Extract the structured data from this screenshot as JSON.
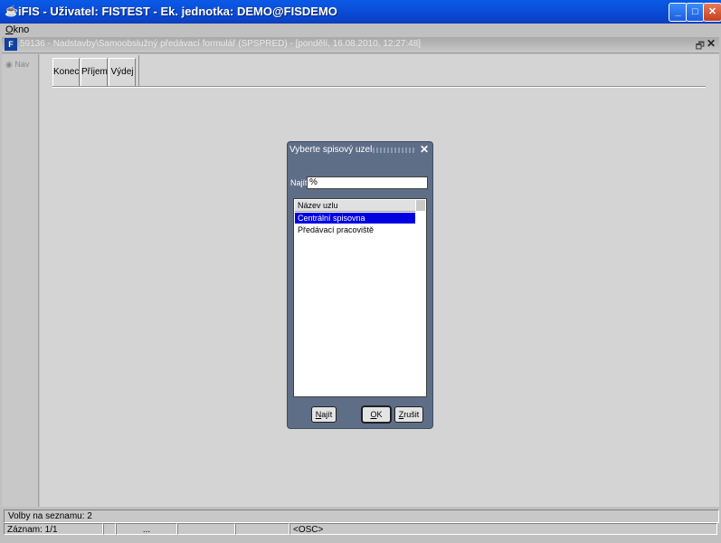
{
  "window": {
    "app_icon": "java-cup-icon",
    "title": "iFIS - Uživatel: FISTEST - Ek. jednotka: DEMO@FISDEMO",
    "minimize": "_",
    "maximize": "□",
    "close": "✕"
  },
  "menubar": {
    "okno_first": "O",
    "okno_rest": "kno"
  },
  "mdi": {
    "icon_text": "F",
    "title": "59136 - Nadstavby\\Samoobslužný předávací formulář (SPSPRED) - [pondělí, 16.08.2010, 12:27:48]",
    "restore": "🗗",
    "close": "✕"
  },
  "left_strip": {
    "nav": "Nav"
  },
  "toolbar": {
    "konec": "Konec",
    "prijem": "Příjem",
    "vydej": "Výdej"
  },
  "dialog": {
    "title": "Vyberte spisový uzel",
    "close": "✕",
    "najit_label": "Najít",
    "search_value": "%",
    "list_header": "Název uzlu",
    "items": [
      "Centrální spisovna",
      "Předávací pracoviště"
    ],
    "btn_najit_first": "N",
    "btn_najit_rest": "ajít",
    "btn_ok_first": "O",
    "btn_ok_rest": "K",
    "btn_zrusit_first": "Z",
    "btn_zrusit_rest": "rušit"
  },
  "status": {
    "volby": "Volby na seznamu: 2",
    "zaznam": "Záznam: 1/1",
    "dots": "...",
    "osc": "<OSC>"
  }
}
